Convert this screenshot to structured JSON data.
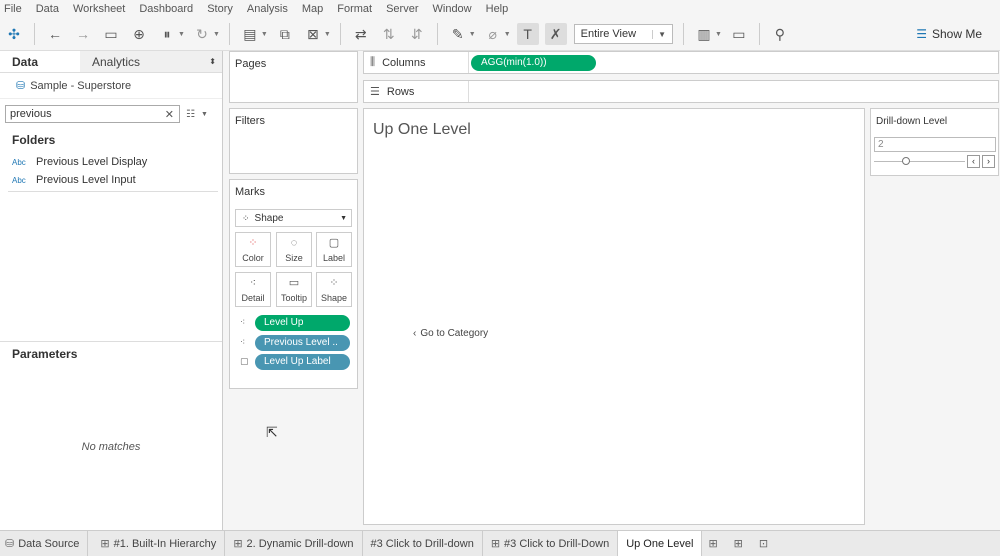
{
  "menu": [
    "File",
    "Data",
    "Worksheet",
    "Dashboard",
    "Story",
    "Analysis",
    "Map",
    "Format",
    "Server",
    "Window",
    "Help"
  ],
  "toolbar": {
    "fit_value": "Entire View",
    "show_me": "Show Me"
  },
  "datapane": {
    "tab_data": "Data",
    "tab_analytics": "Analytics",
    "datasource": "Sample - Superstore",
    "search_value": "previous",
    "folders_label": "Folders",
    "fields": [
      {
        "type": "Abc",
        "name": "Previous Level Display"
      },
      {
        "type": "Abc",
        "name": "Previous Level Input"
      }
    ],
    "parameters_label": "Parameters",
    "no_matches": "No matches"
  },
  "cards": {
    "pages": "Pages",
    "filters": "Filters",
    "marks": "Marks",
    "mark_type": "Shape",
    "mark_buttons": [
      "Color",
      "Size",
      "Label",
      "Detail",
      "Tooltip",
      "Shape"
    ],
    "mark_pills": [
      "Level Up",
      "Previous Level ..",
      "Level Up Label"
    ]
  },
  "shelves": {
    "columns_label": "Columns",
    "columns_pill": "AGG(min(1.0))",
    "rows_label": "Rows"
  },
  "view": {
    "title": "Up One Level",
    "link": "Go to Category"
  },
  "drilldown": {
    "title": "Drill-down Level",
    "value": "2",
    "slider_fraction": 0.35
  },
  "bottom_tabs": [
    "Data Source",
    "#1. Built-In Hierarchy",
    "2. Dynamic Drill-down",
    "#3 Click to Drill-down",
    "#3 Click to Drill-Down",
    "Up One Level"
  ],
  "colors": {
    "green_pill": "#00a86b",
    "blue_pill": "#4996b2",
    "accent": "#1f77b4"
  }
}
